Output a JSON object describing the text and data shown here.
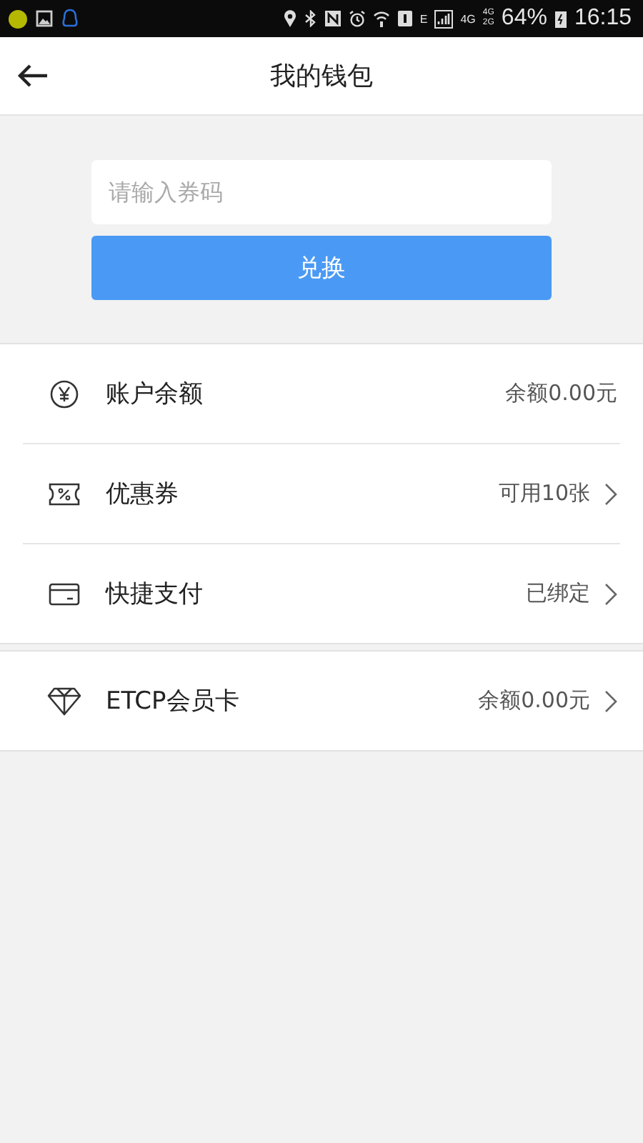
{
  "status_bar": {
    "network_texts": [
      "E",
      "4G"
    ],
    "stacked_network": [
      "4G",
      "2G"
    ],
    "battery": "64%",
    "time": "16:15"
  },
  "header": {
    "title": "我的钱包"
  },
  "redeem": {
    "placeholder": "请输入券码",
    "button": "兑换"
  },
  "groups": [
    {
      "rows": [
        {
          "kind": "balance",
          "label": "账户余额",
          "value": "余额0.00元",
          "chevron": false
        },
        {
          "kind": "coupon",
          "label": "优惠券",
          "value": "可用10张",
          "chevron": true
        },
        {
          "kind": "payment",
          "label": "快捷支付",
          "value": "已绑定",
          "chevron": true
        }
      ]
    },
    {
      "rows": [
        {
          "kind": "membership",
          "label": "ETCP会员卡",
          "value": "余额0.00元",
          "chevron": true
        }
      ]
    }
  ]
}
